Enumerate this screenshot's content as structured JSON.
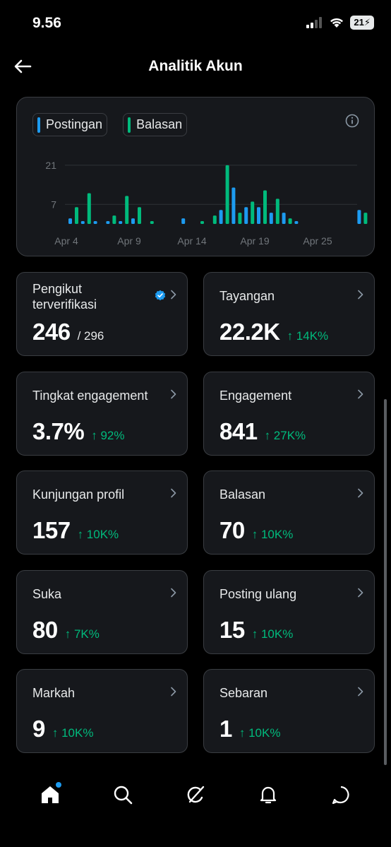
{
  "status": {
    "time": "9.56",
    "battery": "21"
  },
  "header": {
    "title": "Analitik Akun"
  },
  "legend": {
    "posts": "Postingan",
    "replies": "Balasan"
  },
  "colors": {
    "posts": "#1d9bf0",
    "replies": "#00ba7c",
    "positive": "#00ba7c"
  },
  "chart_data": {
    "type": "bar",
    "yticks": [
      7,
      21
    ],
    "ylim": [
      0,
      24
    ],
    "xtick_labels": [
      "Apr 4",
      "Apr 9",
      "Apr 14",
      "Apr 19",
      "Apr 25"
    ],
    "xtick_index": [
      0,
      5,
      10,
      15,
      20
    ],
    "categories": [
      "Apr 4",
      "Apr 5",
      "Apr 6",
      "Apr 7",
      "Apr 8",
      "Apr 9",
      "Apr 10",
      "Apr 11",
      "Apr 12",
      "Apr 13",
      "Apr 14",
      "Apr 15",
      "Apr 16",
      "Apr 17",
      "Apr 18",
      "Apr 19",
      "Apr 20",
      "Apr 21",
      "Apr 22",
      "Apr 23",
      "Apr 24",
      "Apr 25",
      "Apr 26",
      "Apr 27"
    ],
    "series": [
      {
        "name": "Postingan",
        "values": [
          2,
          1,
          1,
          1,
          1,
          2,
          0,
          0,
          0,
          2,
          0,
          0,
          5,
          13,
          6,
          6,
          4,
          4,
          1,
          0,
          0,
          0,
          0,
          5
        ]
      },
      {
        "name": "Balasan",
        "values": [
          6,
          11,
          0,
          3,
          10,
          6,
          1,
          0,
          0,
          0,
          1,
          3,
          21,
          4,
          8,
          12,
          9,
          2,
          0,
          0,
          0,
          0,
          0,
          4
        ]
      }
    ]
  },
  "stats": [
    {
      "label": "Pengikut terverifikasi",
      "value": "246",
      "sub": "/ 296",
      "change": ""
    },
    {
      "label": "Tayangan",
      "value": "22.2K",
      "sub": "",
      "change": "↑ 14K%"
    },
    {
      "label": "Tingkat engagement",
      "value": "3.7%",
      "sub": "",
      "change": "↑ 92%"
    },
    {
      "label": "Engagement",
      "value": "841",
      "sub": "",
      "change": "↑ 27K%"
    },
    {
      "label": "Kunjungan profil",
      "value": "157",
      "sub": "",
      "change": "↑ 10K%"
    },
    {
      "label": "Balasan",
      "value": "70",
      "sub": "",
      "change": "↑ 10K%"
    },
    {
      "label": "Suka",
      "value": "80",
      "sub": "",
      "change": "↑ 7K%"
    },
    {
      "label": "Posting ulang",
      "value": "15",
      "sub": "",
      "change": "↑ 10K%"
    },
    {
      "label": "Markah",
      "value": "9",
      "sub": "",
      "change": "↑ 10K%"
    },
    {
      "label": "Sebaran",
      "value": "1",
      "sub": "",
      "change": "↑ 10K%"
    }
  ],
  "tabs": [
    "home-tab",
    "search-tab",
    "grok-tab",
    "notifications-tab",
    "messages-tab"
  ]
}
